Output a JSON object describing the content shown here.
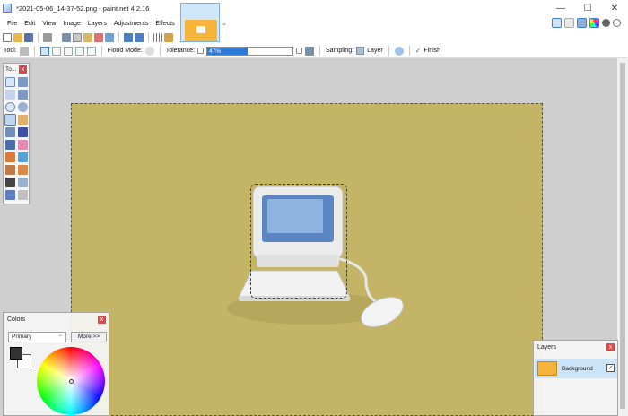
{
  "window": {
    "title": "*2021-05-06_14-37-52.png - paint.net 4.2.16",
    "minimize_glyph": "—",
    "maximize_glyph": "☐",
    "close_glyph": "✕"
  },
  "menu": [
    "File",
    "Edit",
    "View",
    "Image",
    "Layers",
    "Adjustments",
    "Effects"
  ],
  "thumbnail": {
    "dropdown_glyph": "⌄"
  },
  "tool_options": {
    "tool_label": "Tool:",
    "flood_mode_label": "Flood Mode:",
    "tolerance_label": "Tolerance:",
    "tolerance_value": "47%",
    "tolerance_fraction": 0.47,
    "sampling_label": "Sampling:",
    "sampling_value": "Layer",
    "finish_label": "Finish",
    "finish_glyph": "✓"
  },
  "tools_panel": {
    "title": "To...",
    "close_glyph": "x"
  },
  "colors_panel": {
    "title": "Colors",
    "close_glyph": "x",
    "mode_value": "Primary",
    "more_label": "More >>",
    "primary_color": "#333333",
    "secondary_color": "#ffffff"
  },
  "layers_panel": {
    "title": "Layers",
    "close_glyph": "x",
    "layers": [
      {
        "name": "Background",
        "visible_glyph": "✓"
      }
    ]
  },
  "colors": {
    "canvas_bg": "#c4b466",
    "thumbnail_image": "#f7b43a",
    "accent": "#2f7bd9"
  }
}
